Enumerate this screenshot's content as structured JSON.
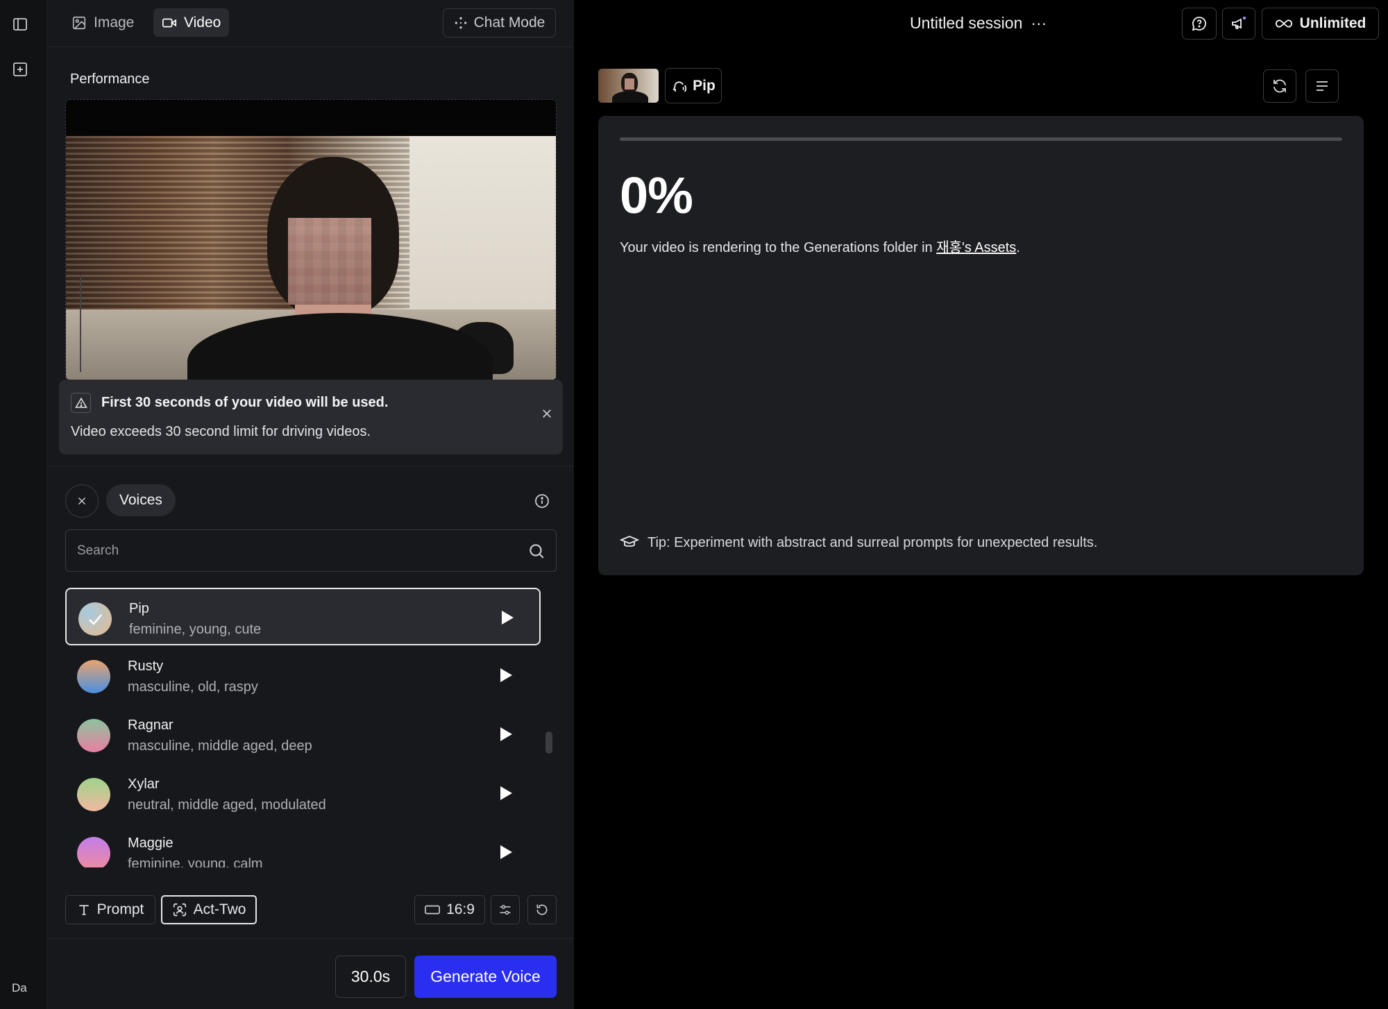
{
  "rail": {
    "user_initials": "Da"
  },
  "topbar": {
    "tabs": [
      {
        "label": "Image"
      },
      {
        "label": "Video"
      }
    ],
    "chat_mode_label": "Chat Mode"
  },
  "performance": {
    "section_title": "Performance",
    "notice_title": "First 30 seconds of your video will be used.",
    "notice_body": "Video exceeds 30 second limit for driving videos."
  },
  "voices": {
    "chip_label": "Voices",
    "search_placeholder": "Search",
    "items": [
      {
        "name": "Pip",
        "desc": "feminine, young, cute"
      },
      {
        "name": "Rusty",
        "desc": "masculine, old, raspy"
      },
      {
        "name": "Ragnar",
        "desc": "masculine, middle aged, deep"
      },
      {
        "name": "Xylar",
        "desc": "neutral, middle aged, modulated"
      },
      {
        "name": "Maggie",
        "desc": "feminine, young, calm"
      }
    ]
  },
  "tools": {
    "prompt_label": "Prompt",
    "act_two_label": "Act-Two",
    "aspect_label": "16:9"
  },
  "footer": {
    "duration": "30.0s",
    "generate_label": "Generate Voice"
  },
  "header": {
    "session_title": "Untitled session",
    "more_label": "···",
    "plan_label": "Unlimited"
  },
  "preview": {
    "pip_label": "Pip"
  },
  "render": {
    "progress_percent": 0,
    "percent_label": "0%",
    "message_prefix": "Your video is rendering to the Generations folder in ",
    "assets_link": "재홍's Assets",
    "message_suffix": ".",
    "tip": "Tip: Experiment with abstract and surreal prompts for unexpected results."
  },
  "colors": {
    "accent": "#2a2ef0",
    "panel_bg": "#17181b",
    "card_bg": "#1d1e22"
  }
}
